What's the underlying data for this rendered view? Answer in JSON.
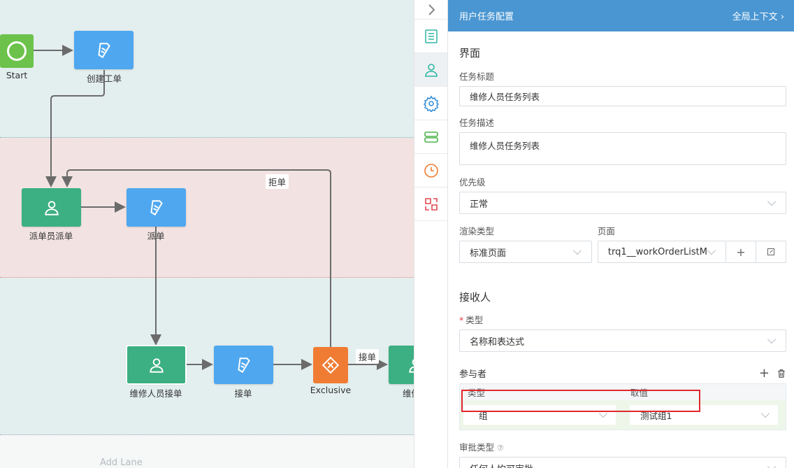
{
  "canvas": {
    "add_lane": "Add Lane",
    "nodes": {
      "start_label": "Start",
      "create_order": "创建工单",
      "dispatcher": "派单员派单",
      "dispatch": "派单",
      "repair_receive": "维修人员接单",
      "receive": "接单",
      "gateway": "Exclusive",
      "repair_partial": "维修人"
    },
    "flows": {
      "reject": "拒单",
      "accept": "接单"
    }
  },
  "rail": {
    "items": [
      "chevron-right-icon",
      "list-icon",
      "user-icon",
      "gear-icon",
      "server-icon",
      "clock-icon",
      "refresh-icon"
    ]
  },
  "panel": {
    "title": "用户任务配置",
    "context_link": "全局上下文 ›",
    "ui_section": "界面",
    "task_title_label": "任务标题",
    "task_title_value": "维修人员任务列表",
    "task_desc_label": "任务描述",
    "task_desc_value": "维修人员任务列表",
    "priority_label": "优先级",
    "priority_value": "正常",
    "render_type_label": "渲染类型",
    "render_type_value": "标准页面",
    "page_label": "页面",
    "page_value": "trq1__workOrderListM",
    "receiver_section": "接收人",
    "type_label": "类型",
    "type_value": "名称和表达式",
    "participants_label": "参与者",
    "col_type": "类型",
    "col_value": "取值",
    "row_type": "组",
    "row_value": "测试组1",
    "approval_label": "审批类型",
    "approval_value": "任何人均可审批"
  },
  "colors": {
    "header": "#4a96d2",
    "task_blue": "#4fa7ef",
    "task_green": "#3caf83",
    "gateway": "#f07c34",
    "start": "#6cc24a",
    "highlight": "#e0282e"
  }
}
